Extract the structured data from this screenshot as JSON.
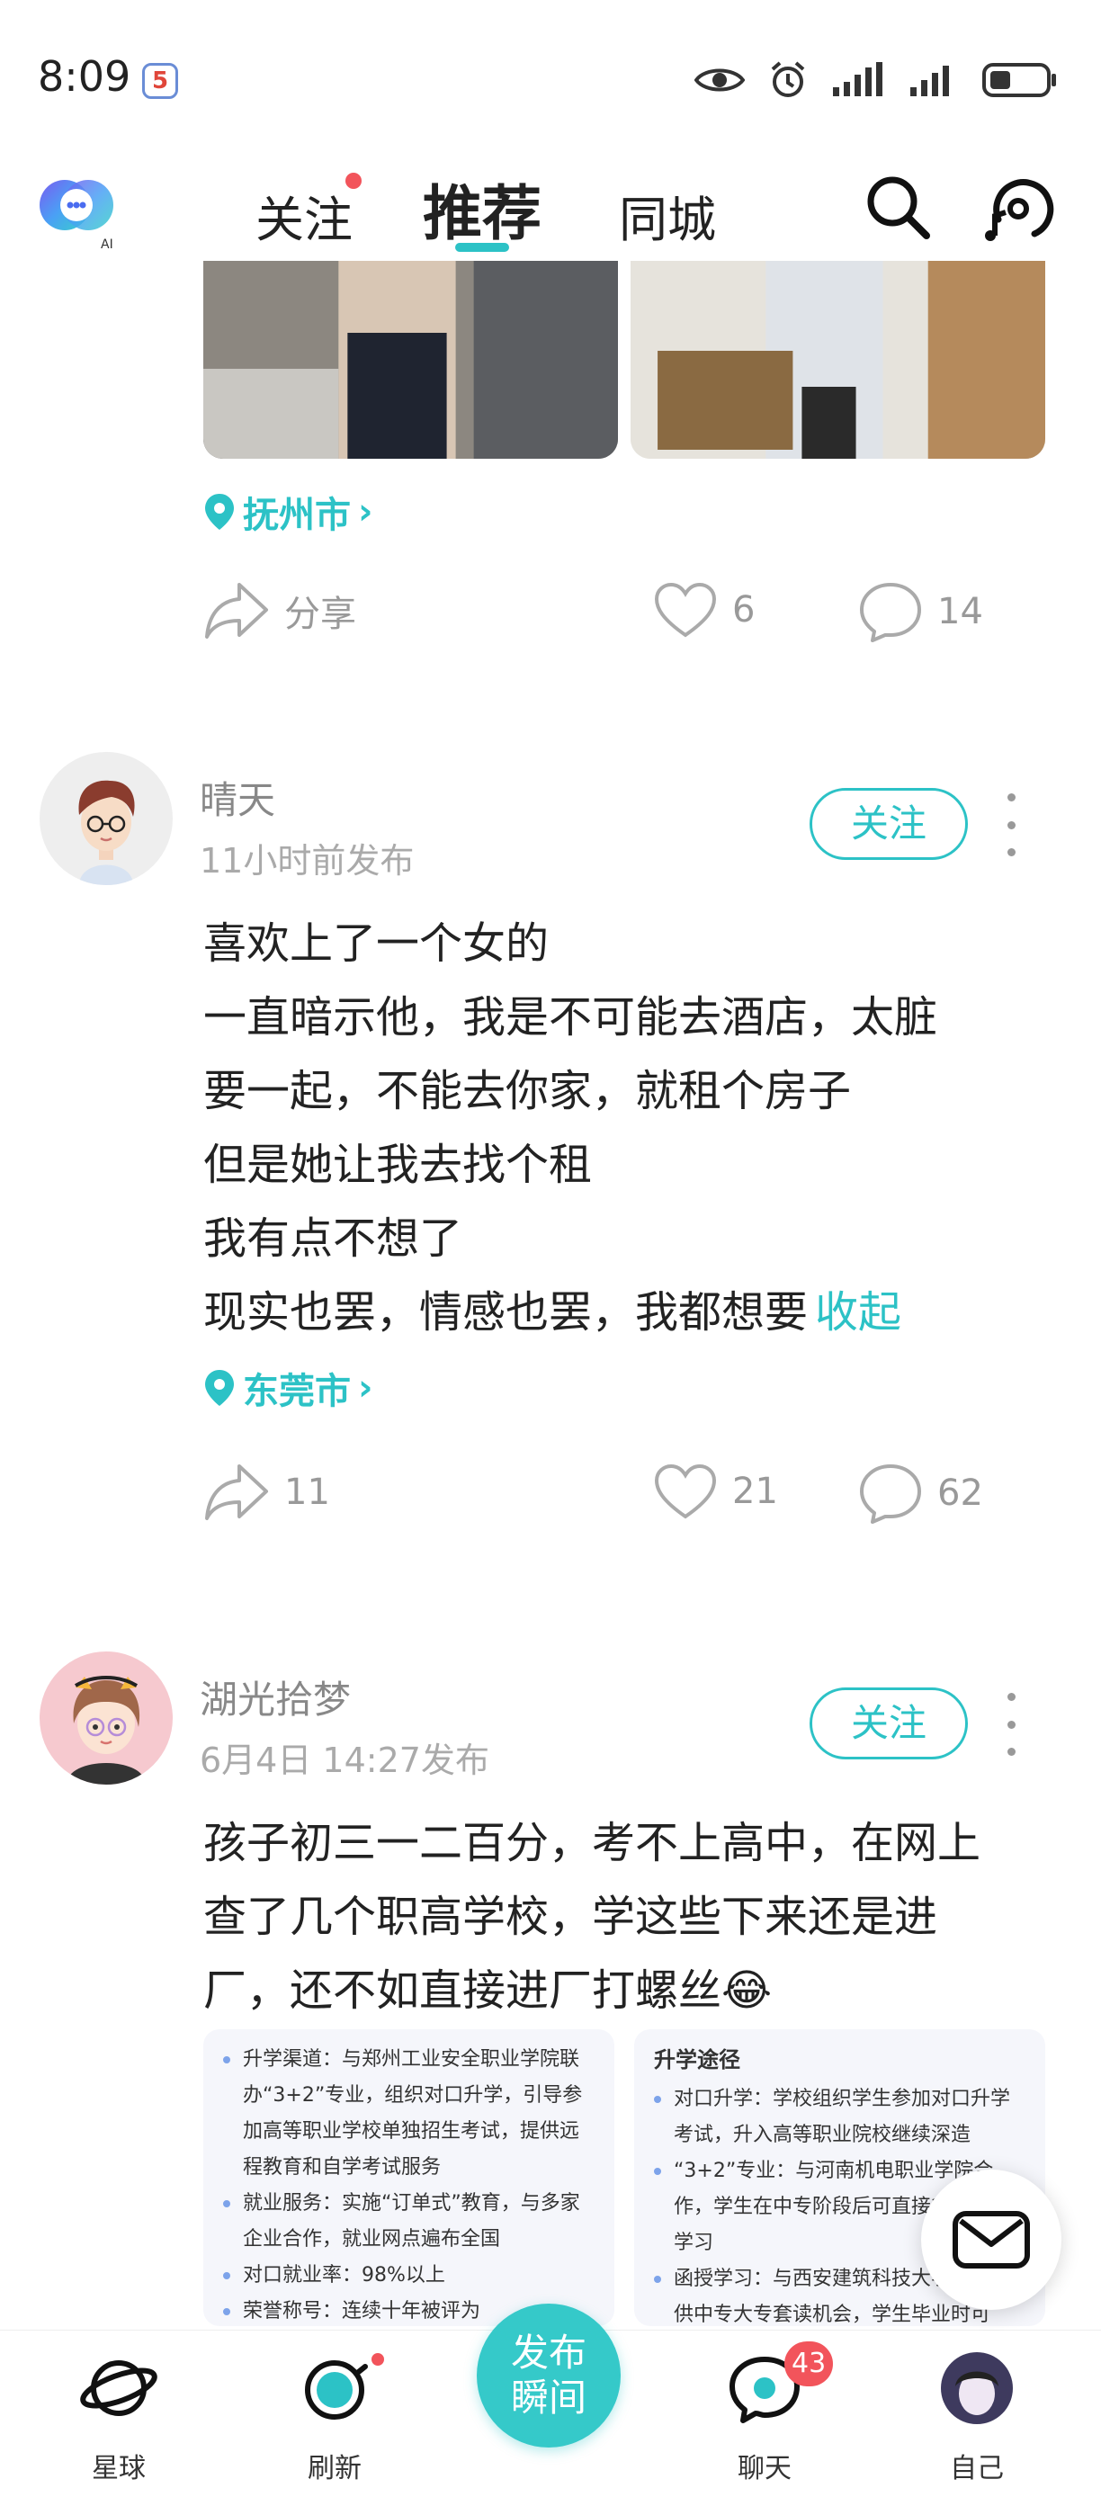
{
  "status_bar": {
    "time": "8:09",
    "badge": "5"
  },
  "top_nav": {
    "tabs": [
      {
        "label": "关注"
      },
      {
        "label": "推荐"
      },
      {
        "label": "同城"
      }
    ],
    "active_tab": "推荐"
  },
  "feed": {
    "prev_post": {
      "location": "抚州市",
      "share_label": "分享",
      "likes": "6",
      "comments": "14"
    },
    "posts": [
      {
        "username": "晴天",
        "time": "11小时前发布",
        "follow_label": "关注",
        "lines": [
          "喜欢上了一个女的",
          "一直暗示他，我是不可能去酒店，太脏",
          "要一起，不能去你家，就租个房子",
          "但是她让我去找个租",
          "我有点不想了",
          "现实也罢，情感也罢，我都想要"
        ],
        "collapse_label": "收起",
        "location": "东莞市",
        "shares": "11",
        "likes": "21",
        "comments": "62"
      },
      {
        "username": "湖光拾梦",
        "time": "6月4日 14:27发布",
        "follow_label": "关注",
        "lines": [
          "孩子初三一二百分，考不上高中，在网上",
          "查了几个职高学校，学这些下来还是进",
          "厂，还不如直接进厂打螺丝😂"
        ],
        "doc_left": {
          "items": [
            "升学渠道：与郑州工业安全职业学院联办“3+2”专业，组织对口升学，引导参加高等职业学校单独招生考试，提供远程教育和自学考试服务",
            "就业服务：实施“订单式”教育，与多家企业合作，就业网点遍布全国",
            "对口就业率：98%以上",
            "荣誉称号：连续十年被评为"
          ]
        },
        "doc_right": {
          "title": "升学途径",
          "items": [
            "对口升学：学校组织学生参加对口升学考试，升入高等职业院校继续深造",
            "“3+2”专业：与河南机电职业学院合作，学生在中专阶段后可直接升入院校学习",
            "函授学习：与西安建筑科技大学合作提供中专大专套读机会，学生毕业时可"
          ]
        }
      }
    ]
  },
  "bottom_nav": {
    "items": [
      {
        "label": "星球"
      },
      {
        "label": "刷新"
      },
      {
        "label": "聊天"
      },
      {
        "label": "自己"
      }
    ],
    "publish_line1": "发布",
    "publish_line2": "瞬间",
    "chat_badge": "43"
  },
  "colors": {
    "accent": "#2cc2c6",
    "badge_red": "#f2545b"
  }
}
